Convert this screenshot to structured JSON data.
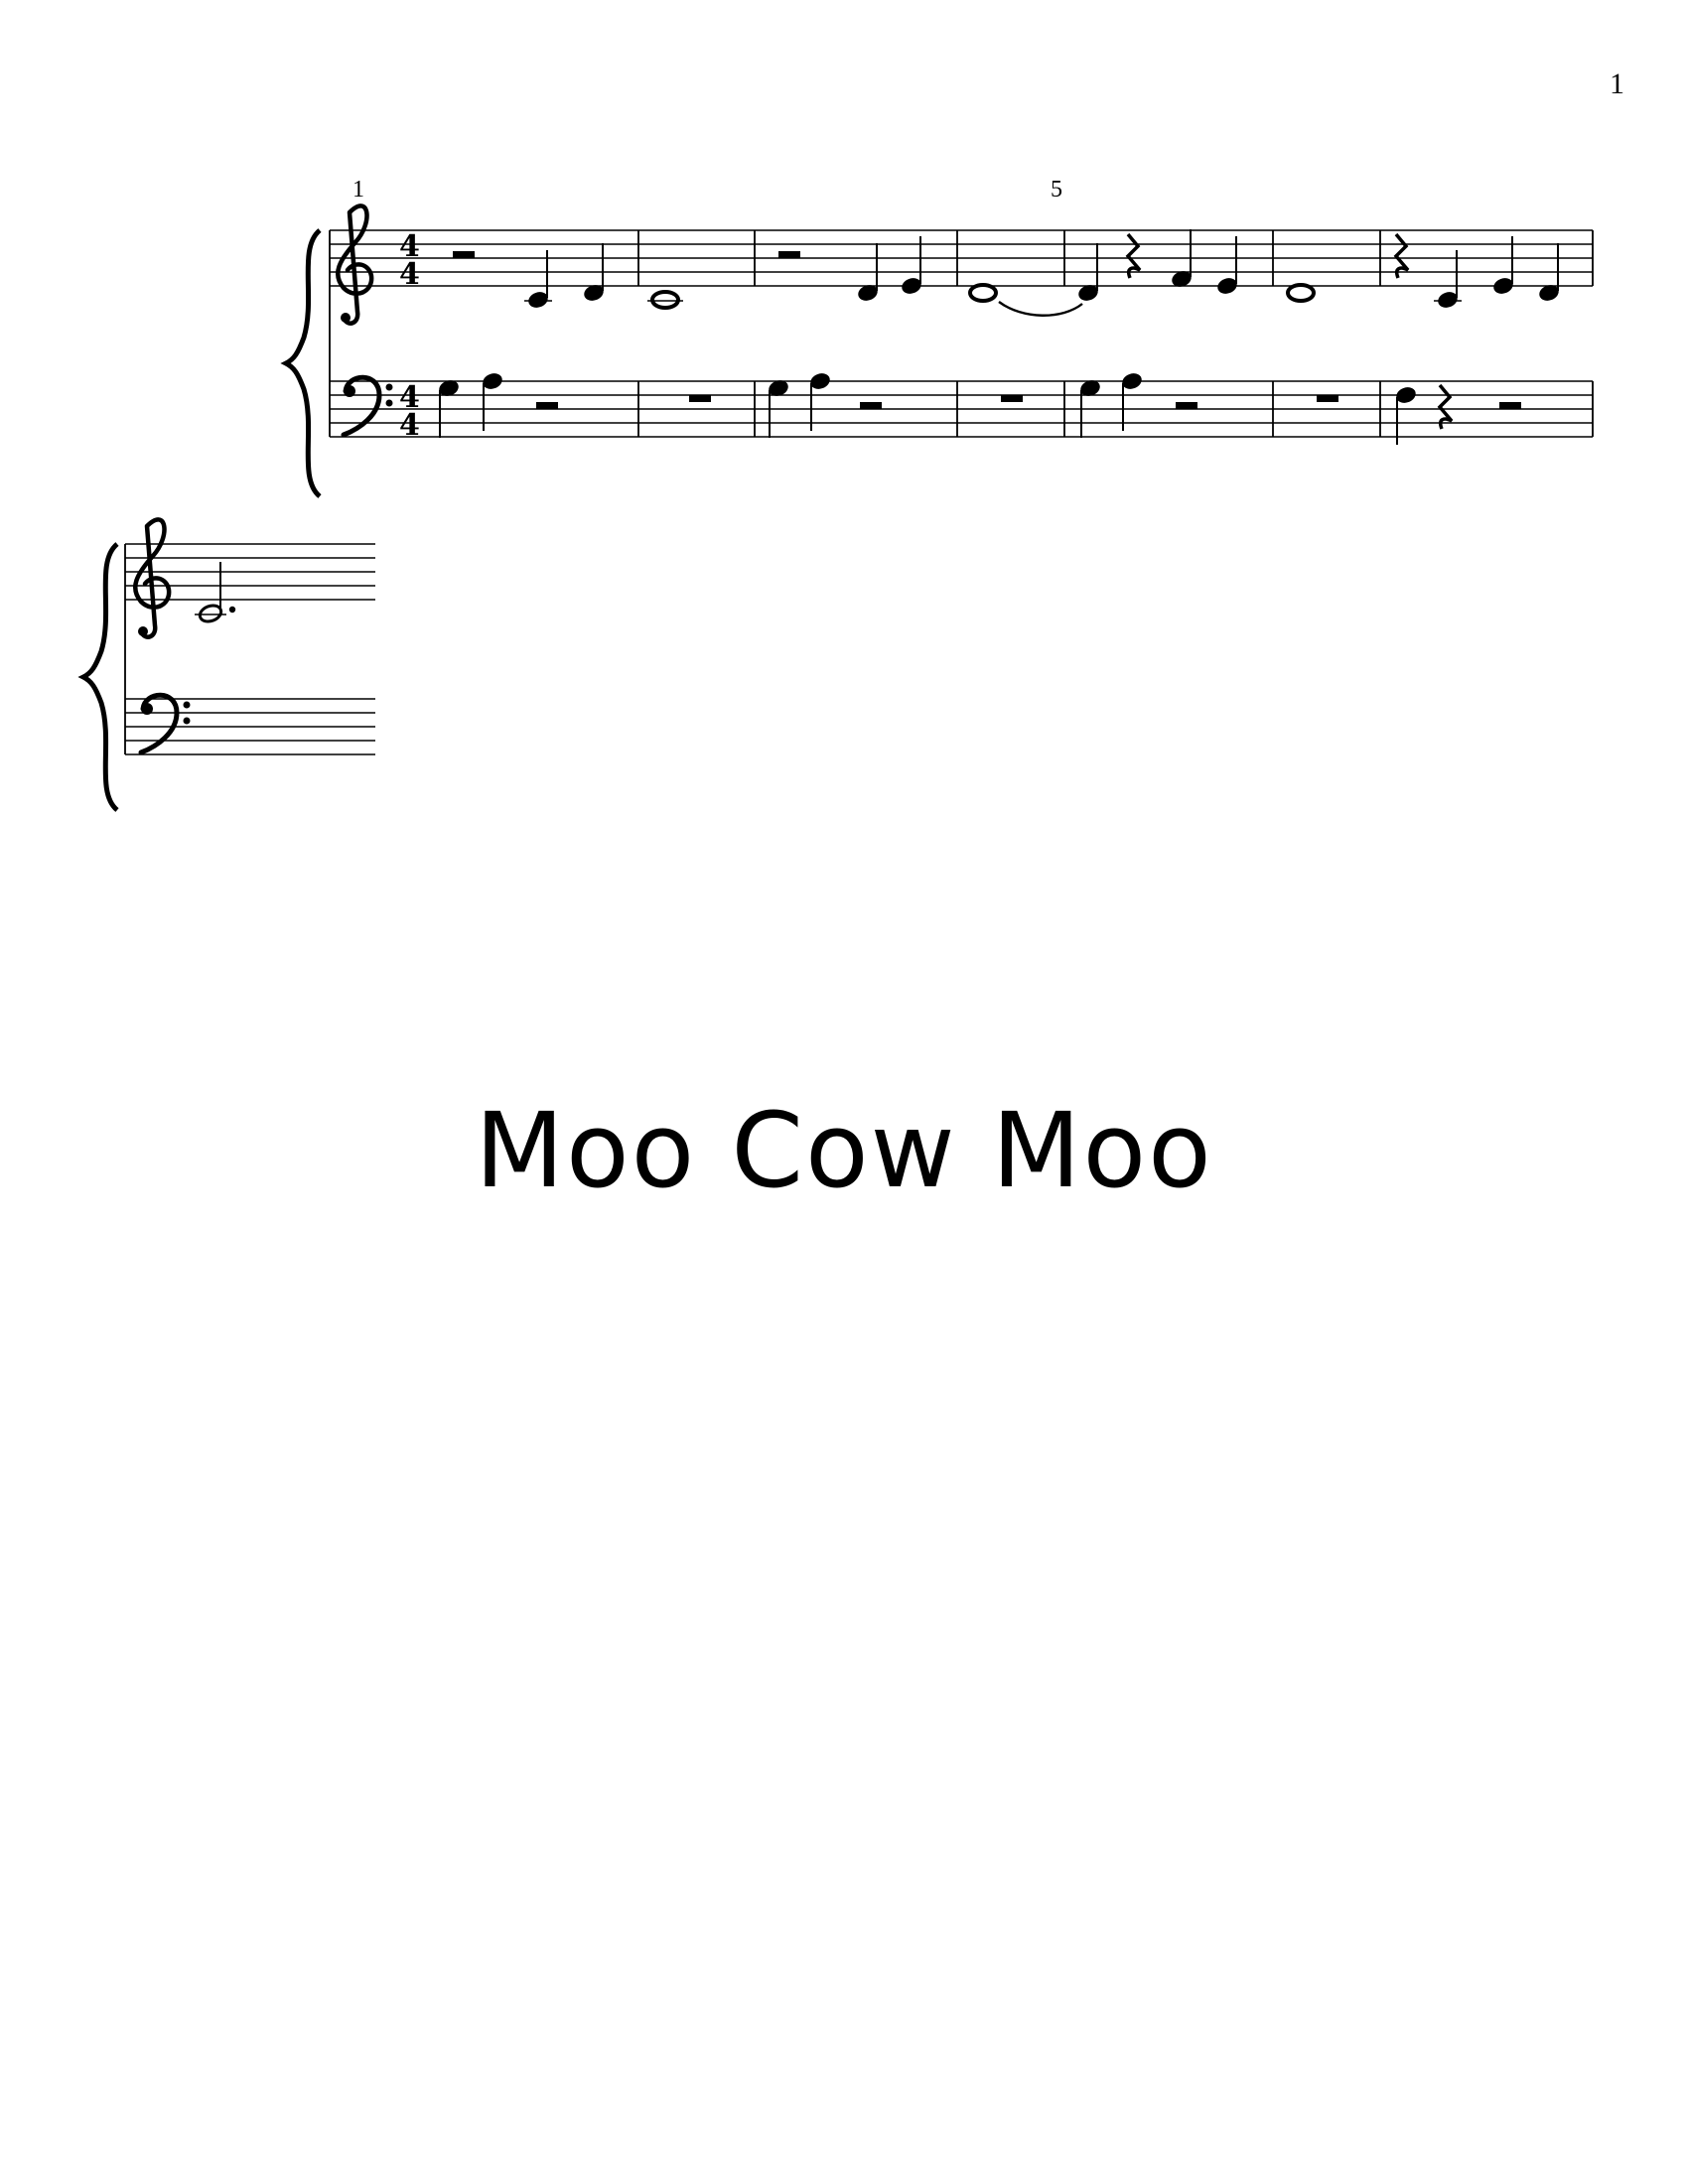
{
  "page_number": "1",
  "measure_numbers": [
    "1",
    "5"
  ],
  "time_signature": {
    "upper": "4",
    "lower": "4"
  },
  "title": "Moo Cow Moo",
  "systems": [
    {
      "measures": 7,
      "treble": [
        [
          "half-rest",
          "C4 quarter",
          "D4 quarter"
        ],
        [
          "C4 whole"
        ],
        [
          "half-rest",
          "D4 quarter",
          "E4 quarter"
        ],
        [
          "D4 whole (tied)"
        ],
        [
          "D4 quarter",
          "quarter-rest",
          "F4 quarter",
          "E4 quarter"
        ],
        [
          "D4 whole"
        ],
        [
          "quarter-rest",
          "C4 quarter",
          "E4 quarter",
          "D4 quarter"
        ]
      ],
      "bass": [
        [
          "G3 quarter",
          "A3 quarter",
          "half-rest"
        ],
        [
          "whole-rest"
        ],
        [
          "G3 quarter",
          "A3 quarter",
          "half-rest"
        ],
        [
          "whole-rest"
        ],
        [
          "G3 quarter",
          "A3 quarter",
          "half-rest"
        ],
        [
          "whole-rest"
        ],
        [
          "F3 quarter",
          "quarter-rest",
          "half-rest"
        ]
      ]
    },
    {
      "measures": 1,
      "treble": [
        [
          "C4 dotted-half"
        ]
      ],
      "bass": [
        []
      ]
    }
  ]
}
